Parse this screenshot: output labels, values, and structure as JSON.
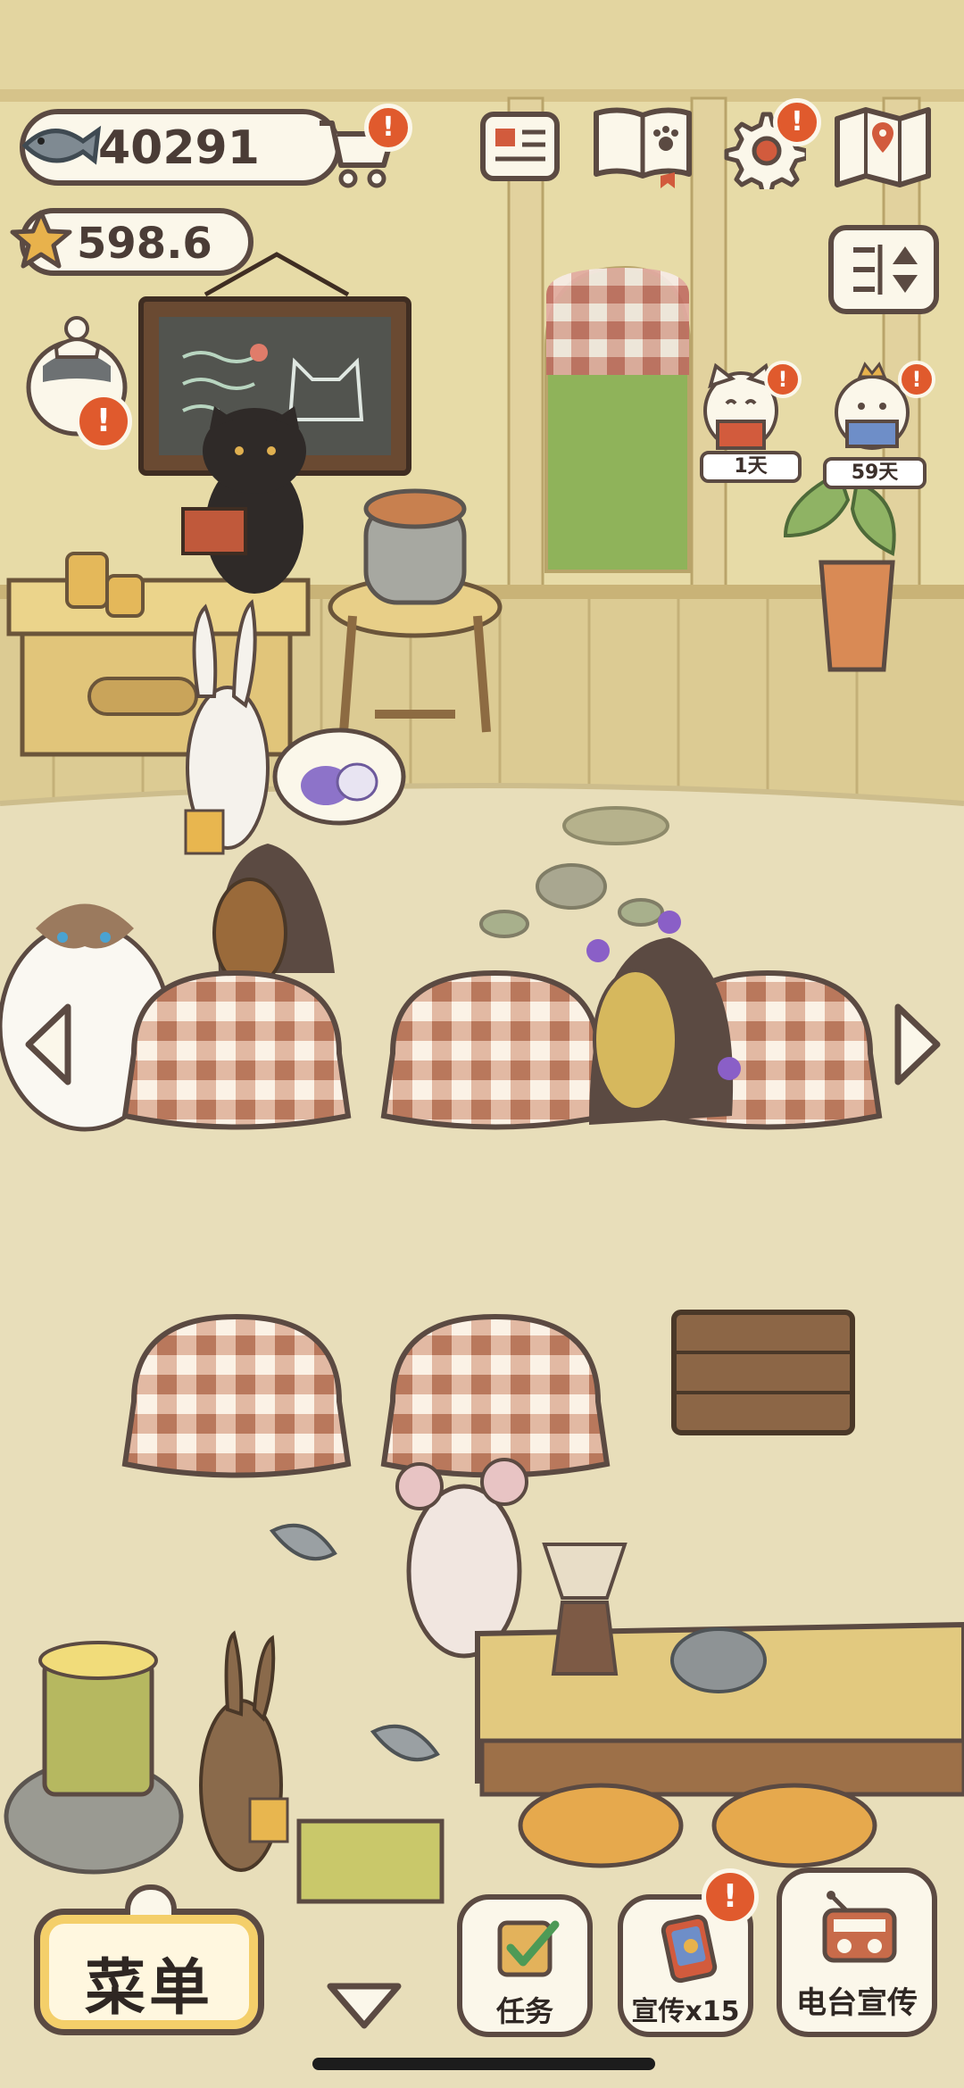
{
  "hud": {
    "fish_currency": "40291",
    "star_currency": "598.6",
    "shop_badge": "!",
    "settings_badge": "!",
    "chef_badge": "!"
  },
  "customers": [
    {
      "label": "1天",
      "badge": "!"
    },
    {
      "label": "59天",
      "badge": "!"
    }
  ],
  "bottom_bar": {
    "menu_label": "菜单",
    "tasks_label": "任务",
    "promo_label": "宣传x15",
    "promo_badge": "!",
    "radio_label": "电台宣传"
  },
  "colors": {
    "outline": "#5b4a42",
    "wall": "#e6d9a6",
    "floor": "#e9dfb9",
    "tablecloth_check": "#c98a6e",
    "alert": "#e05a2d"
  }
}
